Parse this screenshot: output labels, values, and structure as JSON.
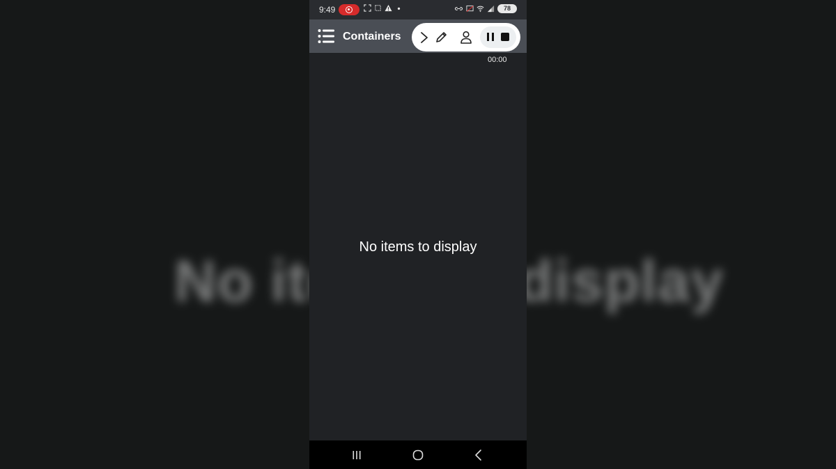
{
  "status_bar": {
    "time": "9:49",
    "battery": "78",
    "icons": [
      "screen-record-icon",
      "screenshot-icon",
      "alert-icon",
      "notification-dot-icon",
      "link-icon",
      "cast-icon",
      "wifi-icon",
      "signal-icon",
      "battery-icon"
    ]
  },
  "app_bar": {
    "title": "Containers",
    "menu_icon": "menu-list-icon"
  },
  "recorder_toolbar": {
    "icons": [
      "chevron-right-icon",
      "pencil-icon",
      "person-icon",
      "pause-icon",
      "stop-icon"
    ],
    "timer": "00:00"
  },
  "main": {
    "empty_message": "No items to display"
  },
  "nav_bar": {
    "icons": [
      "recents-icon",
      "home-icon",
      "back-icon"
    ]
  },
  "colors": {
    "status_bar": "#2a2c30",
    "app_bar": "#4a4e55",
    "content_bg": "#202225",
    "record_red": "#d62b2b",
    "outer_bg": "#161818"
  }
}
